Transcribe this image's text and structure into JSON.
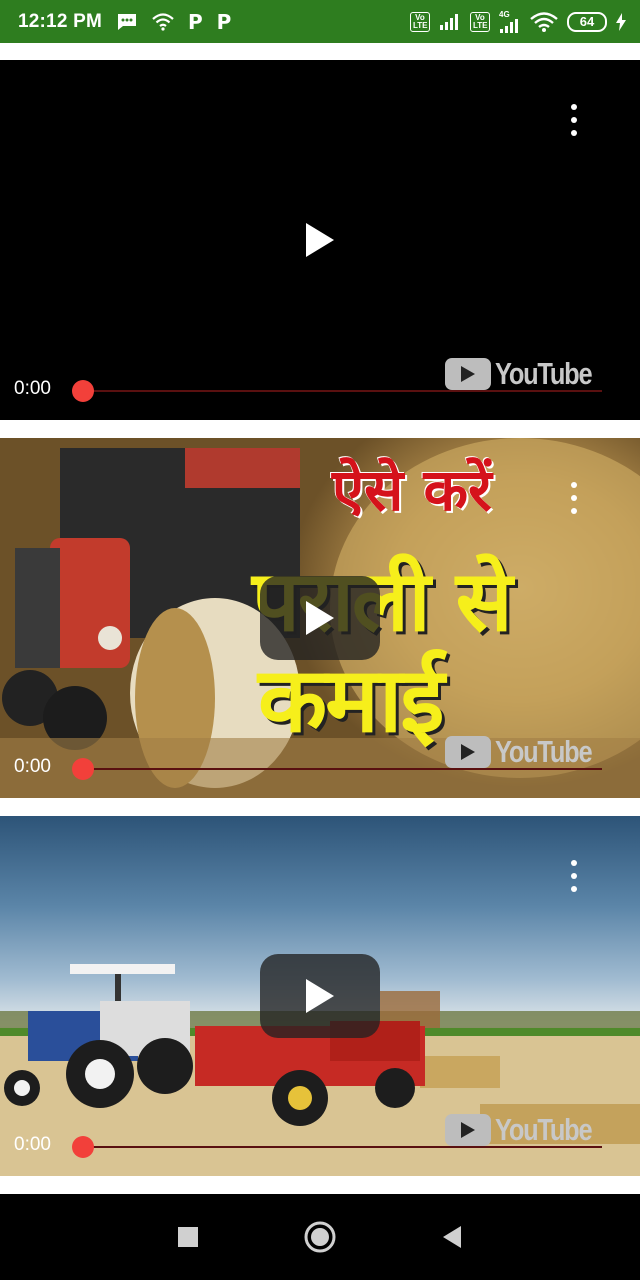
{
  "status_bar": {
    "time": "12:12 PM",
    "battery": "64",
    "sim1_label": "Vo LTE",
    "sim2_label": "Vo LTE",
    "network_label": "4G",
    "notification_icons": [
      "message-icon",
      "wifi-icon",
      "p-icon",
      "p-icon"
    ],
    "p_glyph": "P"
  },
  "videos": [
    {
      "time": "0:00",
      "logo_text": "YouTube",
      "progress": 0
    },
    {
      "time": "0:00",
      "logo_text": "YouTube",
      "progress": 0,
      "overlay_lines": [
        "ऐसे करें",
        "पराली से",
        "कमाई"
      ]
    },
    {
      "time": "0:00",
      "logo_text": "YouTube",
      "progress": 0
    }
  ],
  "colors": {
    "status_bar": "#2e7d1f",
    "progress_knob": "#f2403a",
    "hindi_red": "#d5121b",
    "hindi_yellow": "#f6ef1b"
  },
  "nav_bar": {
    "icons": [
      "recents-square-icon",
      "home-circle-icon",
      "back-triangle-icon"
    ]
  }
}
